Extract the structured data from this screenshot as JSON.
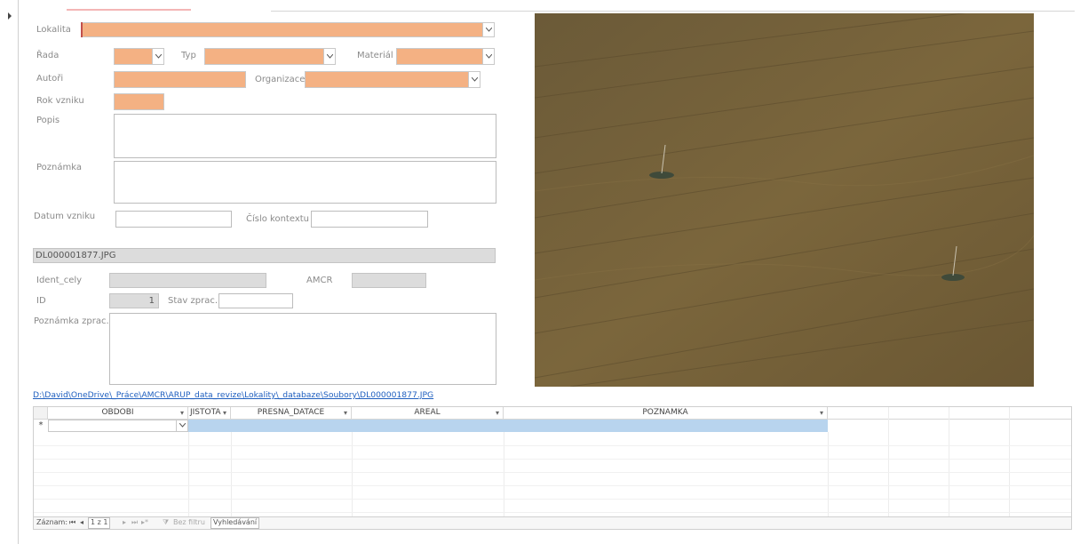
{
  "form": {
    "lokalita_label": "Lokalita",
    "rada_label": "Řada",
    "typ_label": "Typ",
    "material_label": "Materiál",
    "autori_label": "Autoři",
    "organizace_label": "Organizace",
    "rok_label": "Rok vzniku",
    "popis_label": "Popis",
    "poznamka_label": "Poznámka",
    "datum_label": "Datum vzniku",
    "cislo_label": "Číslo kontextu",
    "filename": "DL000001877.JPG",
    "ident_label": "Ident_cely",
    "amcr_label": "AMCR",
    "id_label": "ID",
    "id_value": "1",
    "stav_label": "Stav zprac.",
    "poznamka_zprac_label": "Poznámka zprac.",
    "file_path": "D:\\David\\OneDrive\\_Práce\\AMCR\\ARUP_data_revize\\Lokality\\_databaze\\Soubory\\DL000001877.JPG"
  },
  "photo": {
    "subject": "aerial view of a crop field with two electricity pylons"
  },
  "grid": {
    "columns": [
      "OBDOBI",
      "JISTOTA",
      "PRESNA_DATACE",
      "AREAL",
      "POZNAMKA"
    ],
    "new_row_marker": "*"
  },
  "navigator": {
    "record_label": "Záznam:",
    "position": "1 z 1",
    "filter_label": "Bez filtru",
    "search_label": "Vyhledávání"
  },
  "colors": {
    "required_field": "#f4b183",
    "readonly_field": "#dcdcdc",
    "selected_row": "#b8d4ee",
    "link": "#1f5fbf"
  }
}
